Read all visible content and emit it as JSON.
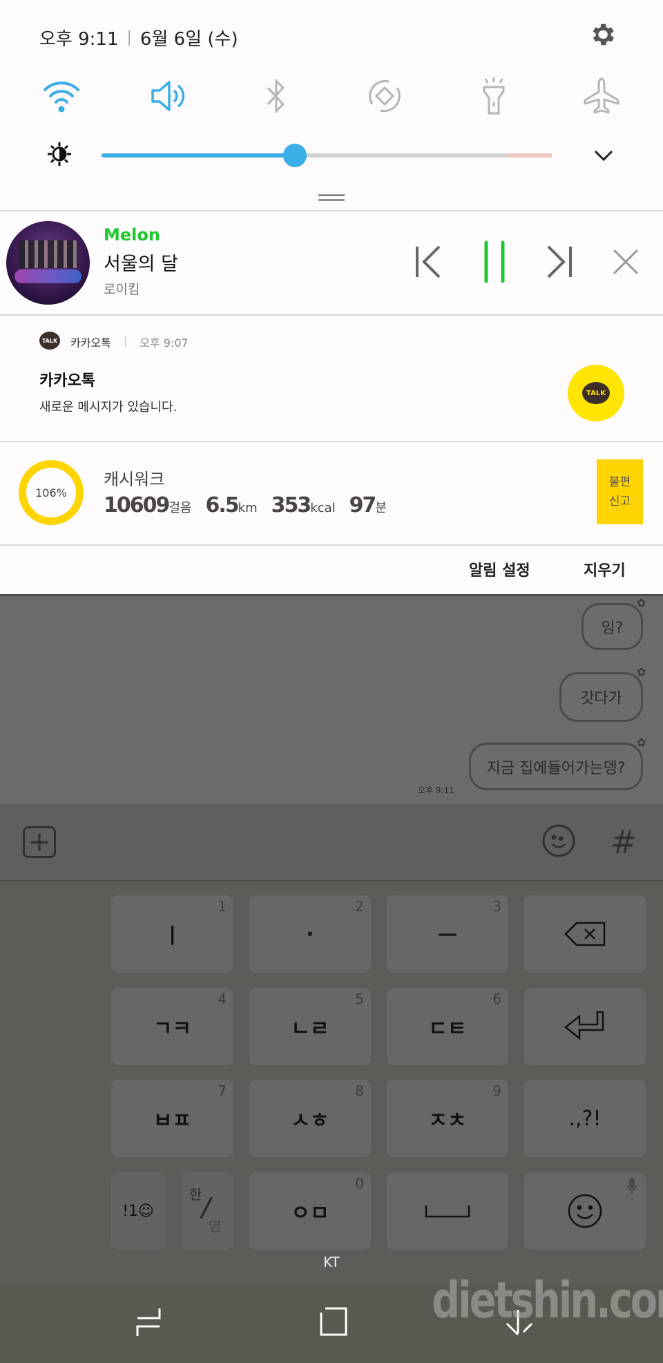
{
  "status": {
    "time": "오후 9:11",
    "separator": "|",
    "date": "6월 6일 (수)"
  },
  "quick_toggles": [
    {
      "icon": "wifi-icon",
      "active": true
    },
    {
      "icon": "sound-icon",
      "active": true
    },
    {
      "icon": "bluetooth-icon",
      "active": false
    },
    {
      "icon": "auto-rotate-icon",
      "active": false
    },
    {
      "icon": "flashlight-icon",
      "active": false
    },
    {
      "icon": "airplane-icon",
      "active": false
    }
  ],
  "brightness": {
    "level_percent": 43
  },
  "colors": {
    "accent": "#3aaee6",
    "melon": "#1ec72b",
    "kakao": "#ffe500",
    "cashwalk": "#ffd400"
  },
  "melon": {
    "app": "Melon",
    "title": "서울의 달",
    "artist": "로이킴"
  },
  "kakao": {
    "app": "카카오톡",
    "separator": "|",
    "time": "오후 9:07",
    "title": "카카오톡",
    "body": "새로운 메시지가 있습니다.",
    "icon_label": "TALK"
  },
  "cashwalk": {
    "percent_label": "106%",
    "percent": 106,
    "title": "캐시워크",
    "steps": "10609",
    "steps_unit": "걸음",
    "distance": "6.5",
    "distance_unit": "km",
    "kcal": "353",
    "kcal_unit": "kcal",
    "minutes": "97",
    "minutes_unit": "분",
    "report_line1": "불편",
    "report_line2": "신고"
  },
  "actions": {
    "settings": "알림 설정",
    "clear": "지우기"
  },
  "chat": {
    "messages": [
      "잉?",
      "갓다가",
      "지금 집에들어가는뎅?"
    ],
    "time": "오후 9:11"
  },
  "keyboard": {
    "rows": [
      [
        {
          "label": "ㅣ",
          "num": "1"
        },
        {
          "label": "·",
          "num": "2"
        },
        {
          "label": "ㅡ",
          "num": "3"
        }
      ],
      [
        {
          "label": "ㄱㅋ",
          "num": "4"
        },
        {
          "label": "ㄴㄹ",
          "num": "5"
        },
        {
          "label": "ㄷㅌ",
          "num": "6"
        }
      ],
      [
        {
          "label": "ㅂㅍ",
          "num": "7"
        },
        {
          "label": "ㅅㅎ",
          "num": "8"
        },
        {
          "label": "ㅈㅊ",
          "num": "9"
        }
      ]
    ],
    "punct": ".,?!",
    "symbols": "!1☺",
    "lang_ko": "한",
    "lang_en": "영",
    "zero_label": "ㅇㅁ",
    "zero_num": "0"
  },
  "carrier": "KT",
  "watermark": "dietshin.com"
}
